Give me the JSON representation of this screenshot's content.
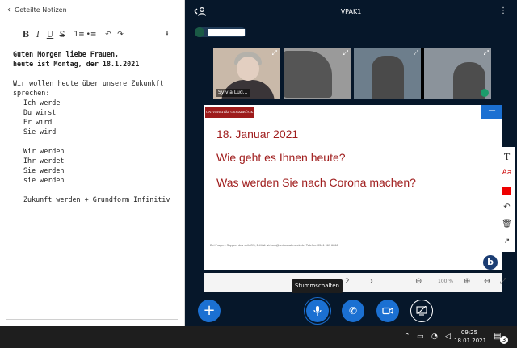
{
  "notes": {
    "back_label": "Geteilte Notizen",
    "toolbar": {
      "bold": "B",
      "italic": "I",
      "underline": "U",
      "strike": "S",
      "ordered_list": "1≡",
      "bullet_list": "•≡",
      "undo": "↶",
      "redo": "↷",
      "download": "⭳"
    },
    "lines": [
      {
        "text": "Guten Morgen liebe Frauen,",
        "bold": true,
        "indent": false
      },
      {
        "text": "heute ist Montag, der 18.1.2021",
        "bold": true,
        "indent": false
      },
      {
        "text": "",
        "bold": false,
        "indent": false
      },
      {
        "text": "Wir wollen heute über unsere Zukunkft",
        "bold": false,
        "indent": false
      },
      {
        "text": "sprechen:",
        "bold": false,
        "indent": false
      },
      {
        "text": "Ich werde",
        "bold": false,
        "indent": true
      },
      {
        "text": "Du wirst",
        "bold": false,
        "indent": true
      },
      {
        "text": "Er wird",
        "bold": false,
        "indent": true
      },
      {
        "text": "Sie wird",
        "bold": false,
        "indent": true
      },
      {
        "text": "",
        "bold": false,
        "indent": false
      },
      {
        "text": "Wir werden",
        "bold": false,
        "indent": true
      },
      {
        "text": "Ihr werdet",
        "bold": false,
        "indent": true
      },
      {
        "text": "Sie werden",
        "bold": false,
        "indent": true
      },
      {
        "text": "sie werden",
        "bold": false,
        "indent": true
      },
      {
        "text": "",
        "bold": false,
        "indent": false
      },
      {
        "text": "Zukunft werden + Grundform Infinitiv",
        "bold": false,
        "indent": true
      }
    ]
  },
  "meeting": {
    "title": "VPAK1",
    "more": "⋮",
    "videos": [
      {
        "name": "Sylvia Lüd...",
        "expand": "⤢"
      },
      {
        "name": "",
        "expand": "⤢"
      },
      {
        "name": "",
        "expand": "⤢"
      },
      {
        "name": "",
        "expand": "⤢"
      }
    ]
  },
  "presentation": {
    "logo_text": "UNIVERSITÄT OSNABRÜCK",
    "minimize": "—",
    "lines": [
      "18. Januar 2021",
      "Wie geht es Ihnen heute?",
      "Was werden Sie nach Corona machen?"
    ],
    "footer": "Bei Fragen: Support des virtUOS; E-Mail: virtuos@uni-osnabrueck.de, Telefon: 0541 969 6666",
    "bbb_logo": "b",
    "controls": {
      "page": "2",
      "next": "›",
      "zoom_out": "⊖",
      "zoom": "100 %",
      "zoom_in": "⊕",
      "fit": "↔",
      "fullscreen": "⤢"
    }
  },
  "whiteboard": {
    "text_tool": "T",
    "font_tool": "Aa",
    "undo": "↶",
    "delete": "🗑",
    "multi": "↗"
  },
  "actions": {
    "plus": "+",
    "mic": "🎙",
    "phone": "✆",
    "camera": "■",
    "screen": "⊘",
    "tooltip": "Stummschalten"
  },
  "taskbar": {
    "up": "⌃",
    "net": "▭",
    "wifi": "◔",
    "volume": "◁",
    "time": "09:25",
    "date": "18.01.2021",
    "notifications": "▤",
    "badge": "3"
  },
  "colors": {
    "meeting_bg": "#06172a",
    "accent": "#1b70d2",
    "slide_text": "#a01e1e"
  }
}
